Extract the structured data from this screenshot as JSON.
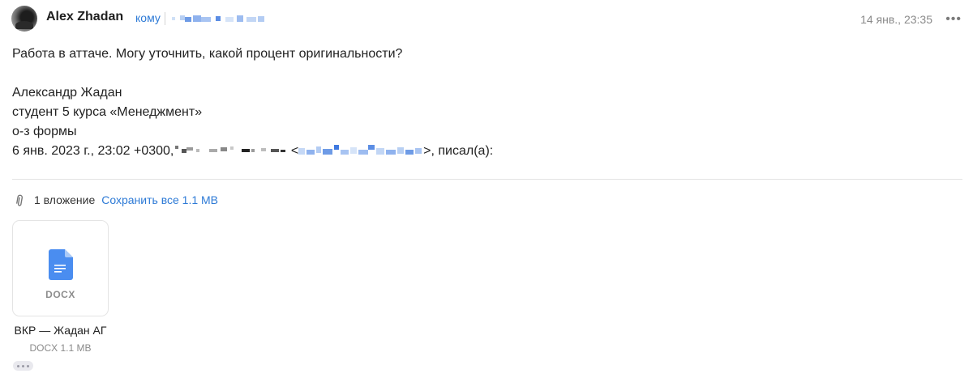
{
  "header": {
    "sender_name": "Alex Zhadan",
    "to_label": "кому",
    "date": "14 янв., 23:35",
    "more_icon": "more-dots-icon",
    "more_label": "•••"
  },
  "message": {
    "line1": "Работа в аттаче. Могу уточнить, какой процент оригинальности?",
    "signature": [
      "Александр Жадан",
      "студент 5 курса «Менеджмент»",
      "о-з формы"
    ],
    "quote_prefix": "6 янв. 2023 г., 23:02 +0300,",
    "quote_lt": "<",
    "quote_suffix": ">, писал(а):"
  },
  "attachments": {
    "clip_icon": "paperclip-icon",
    "count_label": "1 вложение",
    "save_all_label": "Сохранить все 1.1 MB",
    "files": [
      {
        "icon": "docx-file-icon",
        "ext": "DOCX",
        "name": "ВКР — Жадан АГ",
        "meta": "DOCX 1.1 MB"
      }
    ]
  },
  "colors": {
    "link": "#2d7ad6",
    "doc_icon": "#4a8df0",
    "muted": "#8a8a8a"
  }
}
